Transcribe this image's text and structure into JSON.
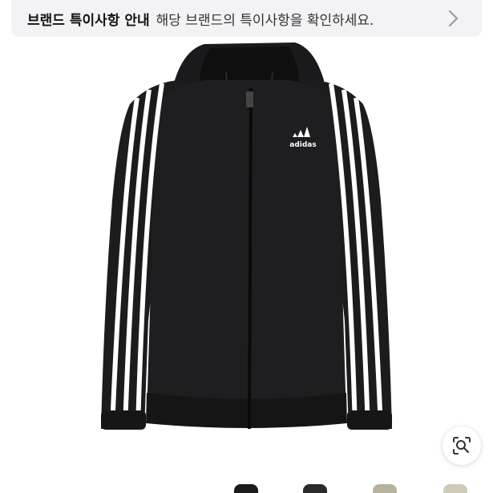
{
  "notice": {
    "title": "브랜드 특이사항 안내",
    "text": "해당 브랜드의 특이사항을 확인하세요."
  },
  "product": {
    "logo_text": "adidas",
    "image_icon": "product-photo-jacket"
  },
  "icons": {
    "notice_chevron": "chevron-right-icon",
    "zoom": "lens-search-icon"
  },
  "colors": {
    "jacket": "#1c1c1e",
    "stripes": "#ffffff",
    "banner_bg": "#f3f3f5"
  }
}
